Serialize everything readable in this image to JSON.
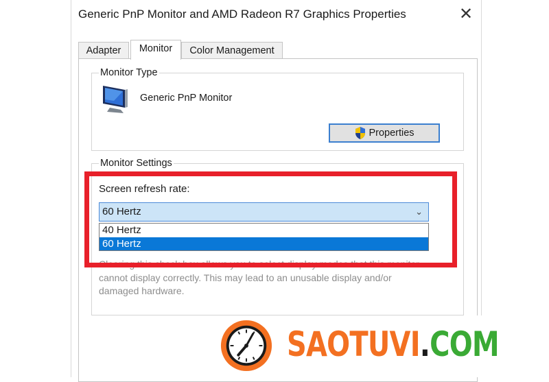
{
  "window": {
    "title": "Generic PnP Monitor and AMD Radeon R7 Graphics Properties",
    "close_glyph": "✕"
  },
  "tabs": [
    {
      "label": "Adapter",
      "active": false
    },
    {
      "label": "Monitor",
      "active": true
    },
    {
      "label": "Color Management",
      "active": false
    }
  ],
  "monitor_type": {
    "group_label": "Monitor Type",
    "monitor_name": "Generic PnP Monitor",
    "icon": "monitor-icon",
    "properties_button": "Properties",
    "properties_icon": "shield-icon"
  },
  "monitor_settings": {
    "group_label": "Monitor Settings",
    "refresh_label": "Screen refresh rate:",
    "selected_value": "60 Hertz",
    "options": [
      "40 Hertz",
      "60 Hertz"
    ],
    "selected_option": "60 Hertz",
    "helper_text": "Clearing this check box allows you to select display modes that this monitor cannot display correctly. This may lead to an unusable display and/or damaged hardware."
  },
  "watermark": {
    "brand_main": "SAOTUVI",
    "brand_dot": ".",
    "brand_tld": "COM",
    "colors": {
      "main": "#f37021",
      "dot": "#1a1a1a",
      "tld": "#3aaa35"
    },
    "icon": "clock-icon"
  },
  "highlight_color": "#e8202a"
}
